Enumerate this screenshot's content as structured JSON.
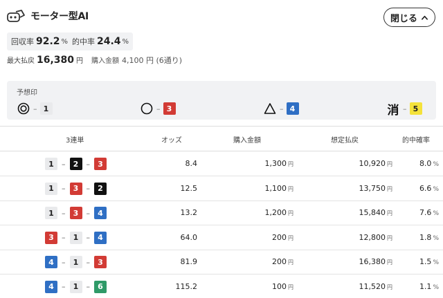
{
  "header": {
    "title": "モーター型AI",
    "close_label": "閉じる",
    "icon": "robot-logo-icon"
  },
  "stats": {
    "recovery": {
      "label": "回収率",
      "value": "92.2",
      "unit": "%"
    },
    "hit": {
      "label": "的中率",
      "value": "24.4",
      "unit": "%"
    }
  },
  "max_payout": {
    "label": "最大払戻",
    "value": "16,380",
    "unit": "円",
    "purchase_label": "購入金額",
    "purchase_value": "4,100 円 (6通り)"
  },
  "marks": {
    "title": "予想印",
    "items": [
      {
        "symbol": "double-circle-icon",
        "dash": "–",
        "number": "1"
      },
      {
        "symbol": "circle-icon",
        "dash": "–",
        "number": "3"
      },
      {
        "symbol": "triangle-icon",
        "dash": "–",
        "number": "4"
      },
      {
        "symbol": "kanji",
        "text": "消",
        "dash": "–",
        "number": "5"
      }
    ]
  },
  "table": {
    "headers": [
      "3連単",
      "オッズ",
      "購入金額",
      "想定払戻",
      "的中確率"
    ],
    "dash": "–",
    "yen": "円",
    "pct": "%",
    "rows": [
      {
        "combo": [
          "1",
          "2",
          "3"
        ],
        "odds": "8.4",
        "purchase": "1,300",
        "payout": "10,920",
        "prob": "8.0"
      },
      {
        "combo": [
          "1",
          "3",
          "2"
        ],
        "odds": "12.5",
        "purchase": "1,100",
        "payout": "13,750",
        "prob": "6.6"
      },
      {
        "combo": [
          "1",
          "3",
          "4"
        ],
        "odds": "13.2",
        "purchase": "1,200",
        "payout": "15,840",
        "prob": "7.6"
      },
      {
        "combo": [
          "3",
          "1",
          "4"
        ],
        "odds": "64.0",
        "purchase": "200",
        "payout": "12,800",
        "prob": "1.8"
      },
      {
        "combo": [
          "4",
          "1",
          "3"
        ],
        "odds": "81.9",
        "purchase": "200",
        "payout": "16,380",
        "prob": "1.5"
      },
      {
        "combo": [
          "4",
          "1",
          "6"
        ],
        "odds": "115.2",
        "purchase": "100",
        "payout": "11,520",
        "prob": "1.1"
      }
    ]
  },
  "colors": {
    "boat1": "#e9eaec",
    "boat2": "#111111",
    "boat3": "#d23b35",
    "boat4": "#2f6fc4",
    "boat5": "#f4e23a",
    "boat6": "#2f9a68"
  }
}
